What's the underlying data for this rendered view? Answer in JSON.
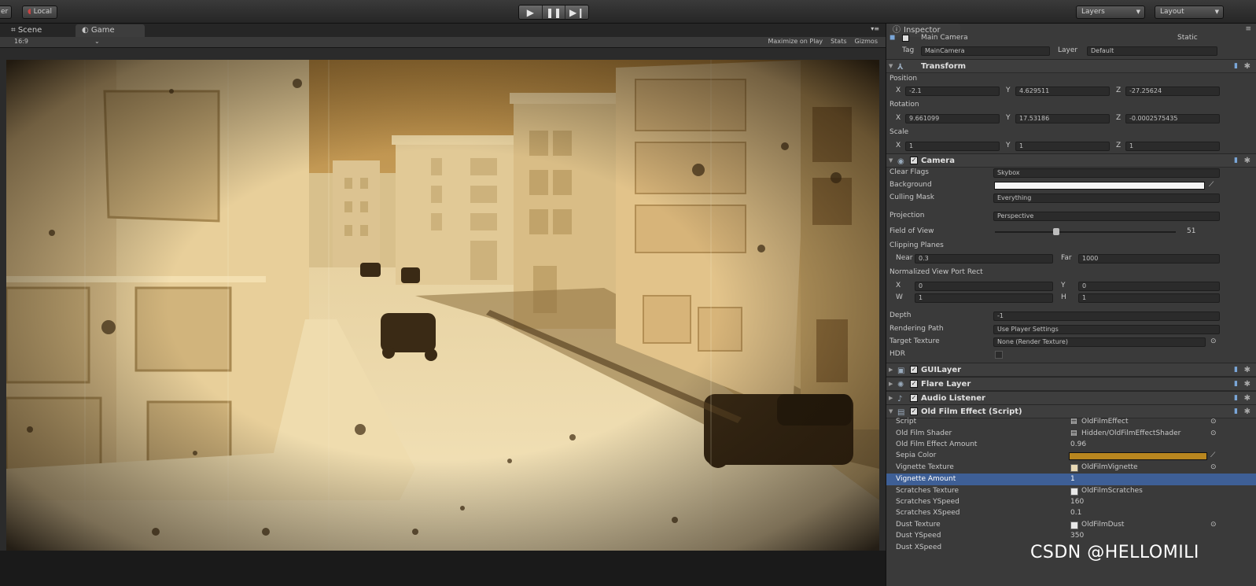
{
  "toolbar": {
    "left_label_partial": "er",
    "layer_label": "Local",
    "layers_dropdown": "Layers",
    "layout_dropdown": "Layout",
    "play_icon": "play-icon",
    "pause_icon": "pause-icon",
    "step_icon": "step-icon"
  },
  "tabs": [
    {
      "label": "Scene",
      "icon": "scene-icon"
    },
    {
      "label": "Game",
      "icon": "game-icon"
    }
  ],
  "game_toolbar": {
    "aspect": "16:9",
    "maximize": "Maximize on Play",
    "stats": "Stats",
    "gizmos": "Gizmos"
  },
  "inspector": {
    "tab_label": "Inspector",
    "tab_menu": "≡",
    "object_name": "Main Camera",
    "static_label": "Static",
    "tag_label": "Tag",
    "tag_value": "MainCamera",
    "layer_label": "Layer",
    "layer_value": "Default",
    "transform": {
      "header": "Transform",
      "position_label": "Position",
      "position": {
        "x": "-2.1",
        "y": "4.629511",
        "z": "-27.25624"
      },
      "rotation_label": "Rotation",
      "rotation": {
        "x": "9.661099",
        "y": "17.53186",
        "z": "-0.0002575435"
      },
      "scale_label": "Scale",
      "scale": {
        "x": "1",
        "y": "1",
        "z": "1"
      }
    },
    "camera": {
      "header": "Camera",
      "clear_flags_label": "Clear Flags",
      "clear_flags": "Skybox",
      "background_label": "Background",
      "culling_mask_label": "Culling Mask",
      "culling_mask": "Everything",
      "projection_label": "Projection",
      "projection": "Perspective",
      "fov_label": "Field of View",
      "fov": "51",
      "fov_fraction": 0.34,
      "clipping_label": "Clipping Planes",
      "near_label": "Near",
      "near": "0.3",
      "far_label": "Far",
      "far": "1000",
      "viewport_label": "Normalized View Port Rect",
      "vp_x": "0",
      "vp_y": "0",
      "vp_w": "1",
      "vp_h": "1",
      "depth_label": "Depth",
      "depth": "-1",
      "rendering_path_label": "Rendering Path",
      "rendering_path": "Use Player Settings",
      "target_texture_label": "Target Texture",
      "target_texture": "None (Render Texture)",
      "hdr_label": "HDR"
    },
    "components": [
      {
        "name": "GUILayer",
        "icon": "guilayer-icon"
      },
      {
        "name": "Flare Layer",
        "icon": "flare-icon"
      },
      {
        "name": "Audio Listener",
        "icon": "audio-icon"
      },
      {
        "name": "Old Film Effect (Script)",
        "icon": "script-icon"
      }
    ],
    "film": {
      "script_label": "Script",
      "script": "OldFilmEffect",
      "shader_label": "Old Film Shader",
      "shader": "Hidden/OldFilmEffectShader",
      "amount_label": "Old Film Effect Amount",
      "amount": "0.96",
      "sepia_label": "Sepia Color",
      "sepia_color": "#b8861f",
      "vignette_tex_label": "Vignette Texture",
      "vignette_tex": "OldFilmVignette",
      "vignette_amount_label": "Vignette Amount",
      "vignette_amount": "1",
      "scratch_tex_label": "Scratches Texture",
      "scratch_tex": "OldFilmScratches",
      "scratch_y_label": "Scratches YSpeed",
      "scratch_y": "160",
      "scratch_x_label": "Scratches XSpeed",
      "scratch_x": "0.1",
      "dust_tex_label": "Dust Texture",
      "dust_tex": "OldFilmDust",
      "dust_y_label": "Dust YSpeed",
      "dust_y": "350",
      "dust_x_label": "Dust XSpeed"
    }
  },
  "watermark": "CSDN @HELLOMILI",
  "colors": {
    "sepia_dark": "#3b2a12",
    "sepia_light": "#f2dba4",
    "selection": "#3e5f96"
  }
}
